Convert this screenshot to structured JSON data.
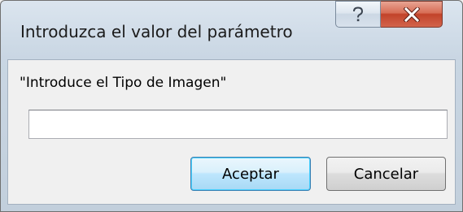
{
  "window": {
    "title": "Introduzca el valor del parámetro"
  },
  "caption_buttons": {
    "help_symbol": "?",
    "close_symbol": "X"
  },
  "dialog": {
    "prompt": "\"Introduce el Tipo de Imagen\"",
    "input_value": "",
    "accept_label": "Aceptar",
    "cancel_label": "Cancelar"
  },
  "icons": {
    "help": "help-icon",
    "close": "close-icon"
  },
  "colors": {
    "title_gradient_top": "#dbe5ef",
    "title_gradient_bottom": "#c2cfdc",
    "close_red": "#c2432a",
    "accept_border_blue": "#3c7fb1",
    "client_bg": "#f0f0f0"
  }
}
